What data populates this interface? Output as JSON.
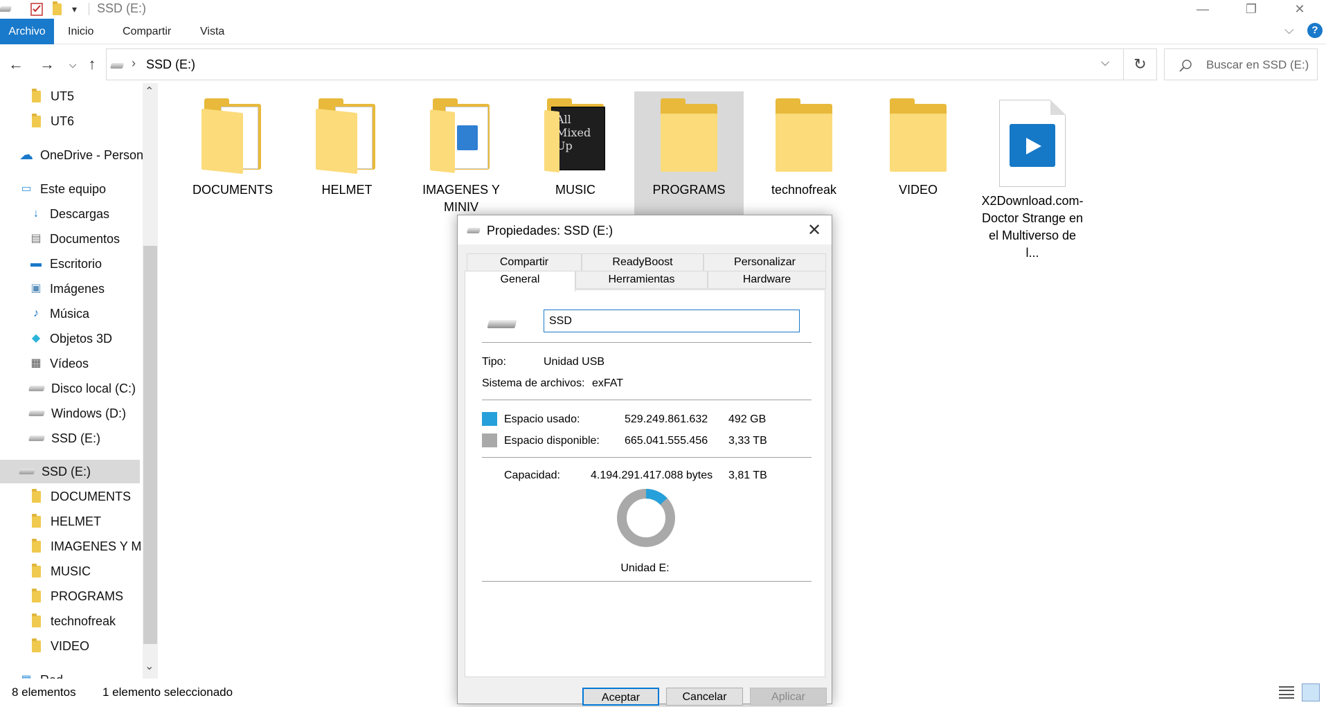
{
  "window": {
    "title": "SSD (E:)",
    "minimize": "—",
    "restore": "❐",
    "close": "✕",
    "qa_dropdown": "▾"
  },
  "ribbon": {
    "tabs": [
      "Archivo",
      "Inicio",
      "Compartir",
      "Vista"
    ],
    "active_tab": "Archivo",
    "expand": "⌵",
    "help": "?"
  },
  "navigation": {
    "back": "←",
    "forward": "→",
    "recent": "⌵",
    "up": "↑",
    "address_chevron": "›",
    "address": "SSD (E:)",
    "dropdown": "⌵",
    "refresh": "↻",
    "search_placeholder": "Buscar en SSD (E:)"
  },
  "sidebar": {
    "items": [
      {
        "label": "UT5",
        "icon": "folder-icon"
      },
      {
        "label": "UT6",
        "icon": "folder-icon"
      },
      {
        "label": "OneDrive - Person",
        "icon": "cloud-icon"
      },
      {
        "label": "Este equipo",
        "icon": "computer-icon"
      },
      {
        "label": "Descargas",
        "icon": "download-icon"
      },
      {
        "label": "Documentos",
        "icon": "document-icon"
      },
      {
        "label": "Escritorio",
        "icon": "desktop-icon"
      },
      {
        "label": "Imágenes",
        "icon": "pictures-icon"
      },
      {
        "label": "Música",
        "icon": "music-icon"
      },
      {
        "label": "Objetos 3D",
        "icon": "cube-icon"
      },
      {
        "label": "Vídeos",
        "icon": "film-icon"
      },
      {
        "label": "Disco local (C:)",
        "icon": "drive-icon"
      },
      {
        "label": "Windows (D:)",
        "icon": "drive-icon"
      },
      {
        "label": "SSD (E:)",
        "icon": "drive-icon"
      },
      {
        "label": "SSD (E:)",
        "icon": "drive-icon"
      },
      {
        "label": "DOCUMENTS",
        "icon": "folder-icon"
      },
      {
        "label": "HELMET",
        "icon": "folder-icon"
      },
      {
        "label": "IMAGENES Y MINI",
        "icon": "folder-icon"
      },
      {
        "label": "MUSIC",
        "icon": "folder-icon"
      },
      {
        "label": "PROGRAMS",
        "icon": "folder-icon"
      },
      {
        "label": "technofreak",
        "icon": "folder-icon"
      },
      {
        "label": "VIDEO",
        "icon": "folder-icon"
      },
      {
        "label": "Red",
        "icon": "network-icon"
      }
    ],
    "scroll_up": "⌃",
    "scroll_down": "⌄"
  },
  "files": [
    {
      "name": "DOCUMENTS",
      "type": "folder-docs"
    },
    {
      "name": "HELMET",
      "type": "folder-docs"
    },
    {
      "name": "IMAGENES Y MINIV",
      "type": "folder-image"
    },
    {
      "name": "MUSIC",
      "type": "folder-album"
    },
    {
      "name": "PROGRAMS",
      "type": "folder",
      "selected": true
    },
    {
      "name": "technofreak",
      "type": "folder"
    },
    {
      "name": "VIDEO",
      "type": "folder"
    },
    {
      "name": "X2Download.com-Doctor Strange en el Multiverso de l...",
      "type": "video-file"
    }
  ],
  "music_cover_text": "All Mixed Up",
  "status": {
    "count": "8 elementos",
    "selection": "1 elemento seleccionado"
  },
  "dialog": {
    "title": "Propiedades: SSD (E:)",
    "close": "✕",
    "tabs_row1": [
      "Compartir",
      "ReadyBoost",
      "Personalizar"
    ],
    "tabs_row2": [
      "General",
      "Herramientas",
      "Hardware"
    ],
    "active_tab": "General",
    "name_value": "SSD",
    "tipo_label": "Tipo:",
    "tipo_value": "Unidad USB",
    "fs_label": "Sistema de archivos:",
    "fs_value": "exFAT",
    "used_label": "Espacio usado:",
    "used_bytes": "529.249.861.632",
    "used_human": "492 GB",
    "free_label": "Espacio disponible:",
    "free_bytes": "665.041.555.456",
    "free_human": "3,33 TB",
    "capacity_label": "Capacidad:",
    "capacity_bytes": "4.194.291.417.088 bytes",
    "capacity_human": "3,81 TB",
    "drive_label": "Unidad E:",
    "used_fraction": 0.13,
    "used_color": "#26a0da",
    "free_color": "#a9a9a9",
    "buttons": {
      "ok": "Aceptar",
      "cancel": "Cancelar",
      "apply": "Aplicar"
    }
  }
}
